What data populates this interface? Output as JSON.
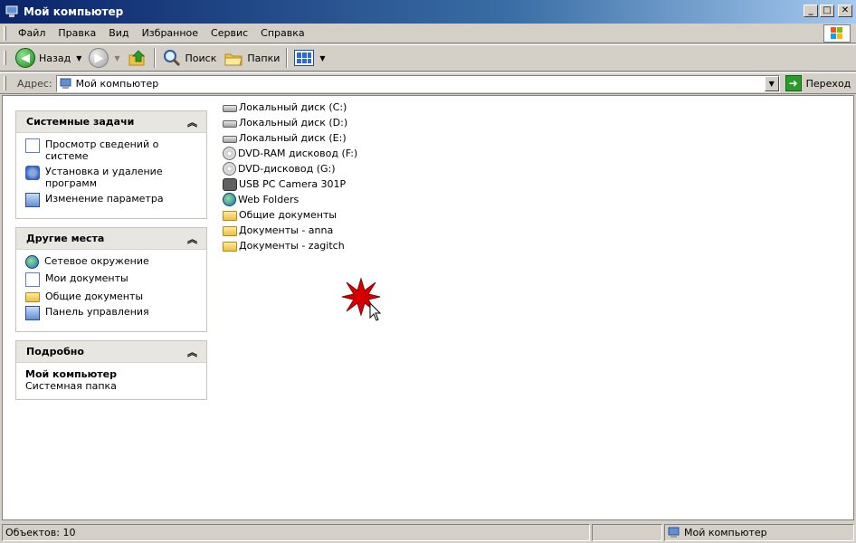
{
  "window": {
    "title": "Мой компьютер"
  },
  "menu": {
    "items": [
      {
        "label": "Файл"
      },
      {
        "label": "Правка"
      },
      {
        "label": "Вид"
      },
      {
        "label": "Избранное"
      },
      {
        "label": "Сервис"
      },
      {
        "label": "Справка"
      }
    ]
  },
  "toolbar": {
    "back_label": "Назад",
    "search_label": "Поиск",
    "folders_label": "Папки"
  },
  "address": {
    "label": "Адрес:",
    "value": "Мой компьютер",
    "go_label": "Переход"
  },
  "panels": {
    "system_tasks": {
      "title": "Системные задачи",
      "items": [
        {
          "label": "Просмотр сведений о системе",
          "icon": "system-info-icon"
        },
        {
          "label": "Установка и удаление программ",
          "icon": "add-remove-icon"
        },
        {
          "label": "Изменение параметра",
          "icon": "control-panel-icon"
        }
      ]
    },
    "other_places": {
      "title": "Другие места",
      "items": [
        {
          "label": "Сетевое окружение",
          "icon": "network-icon"
        },
        {
          "label": "Мои документы",
          "icon": "documents-icon"
        },
        {
          "label": "Общие документы",
          "icon": "folder-icon"
        },
        {
          "label": "Панель управления",
          "icon": "control-panel-icon"
        }
      ]
    },
    "details": {
      "title": "Подробно",
      "name": "Мой компьютер",
      "type": "Системная папка"
    }
  },
  "files": [
    {
      "label": "Локальный диск (C:)",
      "icon": "hard-drive-icon"
    },
    {
      "label": "Локальный диск (D:)",
      "icon": "hard-drive-icon"
    },
    {
      "label": "Локальный диск (E:)",
      "icon": "hard-drive-icon"
    },
    {
      "label": "DVD-RAM дисковод (F:)",
      "icon": "dvd-drive-icon"
    },
    {
      "label": "DVD-дисковод (G:)",
      "icon": "dvd-drive-icon"
    },
    {
      "label": "USB PC Camera 301P",
      "icon": "camera-icon"
    },
    {
      "label": "Web Folders",
      "icon": "web-folders-icon"
    },
    {
      "label": "Общие документы",
      "icon": "folder-icon"
    },
    {
      "label": "Документы - anna",
      "icon": "folder-icon"
    },
    {
      "label": "Документы - zagitch",
      "icon": "folder-icon"
    }
  ],
  "status": {
    "objects": "Объектов: 10",
    "location": "Мой компьютер"
  },
  "colors": {
    "title_bar": "#0a246a",
    "window_bg": "#d4d0c8",
    "panel_header": "#e8e6e0",
    "click_burst": "#d40000"
  }
}
